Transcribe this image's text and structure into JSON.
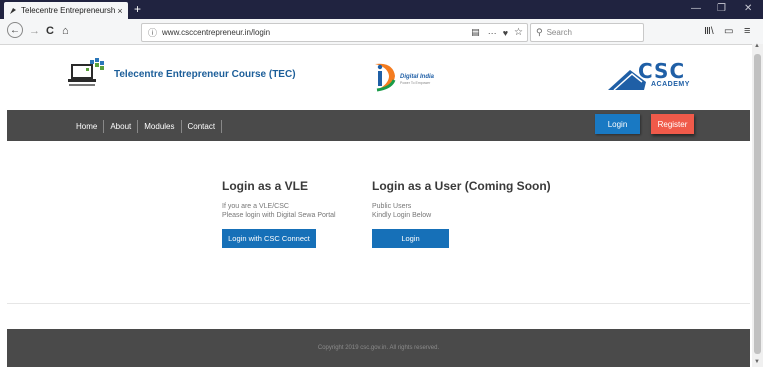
{
  "browser": {
    "tab_title": "Telecentre Entrepreneurship C",
    "tab_close": "×",
    "new_tab": "+",
    "url": "www.csccentrepreneur.in/login",
    "search_placeholder": "Search",
    "win_min": "—",
    "win_max": "❐",
    "win_close": "✕",
    "back": "←",
    "forward": "→",
    "reload": "C",
    "home": "⌂",
    "more": "···"
  },
  "header": {
    "brand_title": "Telecentre Entrepreneur Course (TEC)",
    "digital_india": "Digital India",
    "digital_india_tagline": "Power To Empower",
    "csc_academy": "ACADEMY",
    "csc_letters": "CSC"
  },
  "nav": {
    "items": [
      "Home",
      "About",
      "Modules",
      "Contact"
    ],
    "login": "Login",
    "register": "Register"
  },
  "vle": {
    "title": "Login as a VLE",
    "line1": "If you are a VLE/CSC",
    "line2": "Please login with Digital Sewa Portal",
    "button": "Login with CSC Connect"
  },
  "user": {
    "title": "Login as a User (Coming Soon)",
    "line1": "Public Users",
    "line2": "Kindly Login Below",
    "button": "Login"
  },
  "footer": {
    "text": "Copyright 2019 csc.gov.in. All rights reserved."
  },
  "colors": {
    "accent_blue": "#1979c3",
    "register_red": "#f05a4a",
    "nav_dark": "#4a4a4a"
  }
}
